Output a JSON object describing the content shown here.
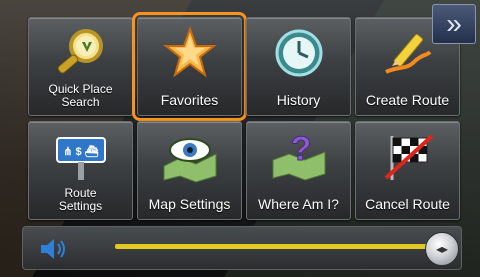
{
  "menu": {
    "items": [
      {
        "label": "Quick Place\nSearch",
        "icon": "magnifier-icon"
      },
      {
        "label": "Favorites",
        "icon": "star-icon",
        "selected": true
      },
      {
        "label": "History",
        "icon": "clock-icon"
      },
      {
        "label": "Create Route",
        "icon": "pencil-route-icon"
      },
      {
        "label": "Route\nSettings",
        "icon": "road-sign-icon"
      },
      {
        "label": "Map Settings",
        "icon": "eye-map-icon"
      },
      {
        "label": "Where Am I?",
        "icon": "question-map-icon"
      },
      {
        "label": "Cancel Route",
        "icon": "checkered-flag-cancel-icon"
      }
    ],
    "next_arrow": "»"
  },
  "volume": {
    "level": 1.0,
    "knob_glyph": "◂▸"
  },
  "colors": {
    "selection": "#f7941d",
    "volume_track": "#e2c822"
  }
}
